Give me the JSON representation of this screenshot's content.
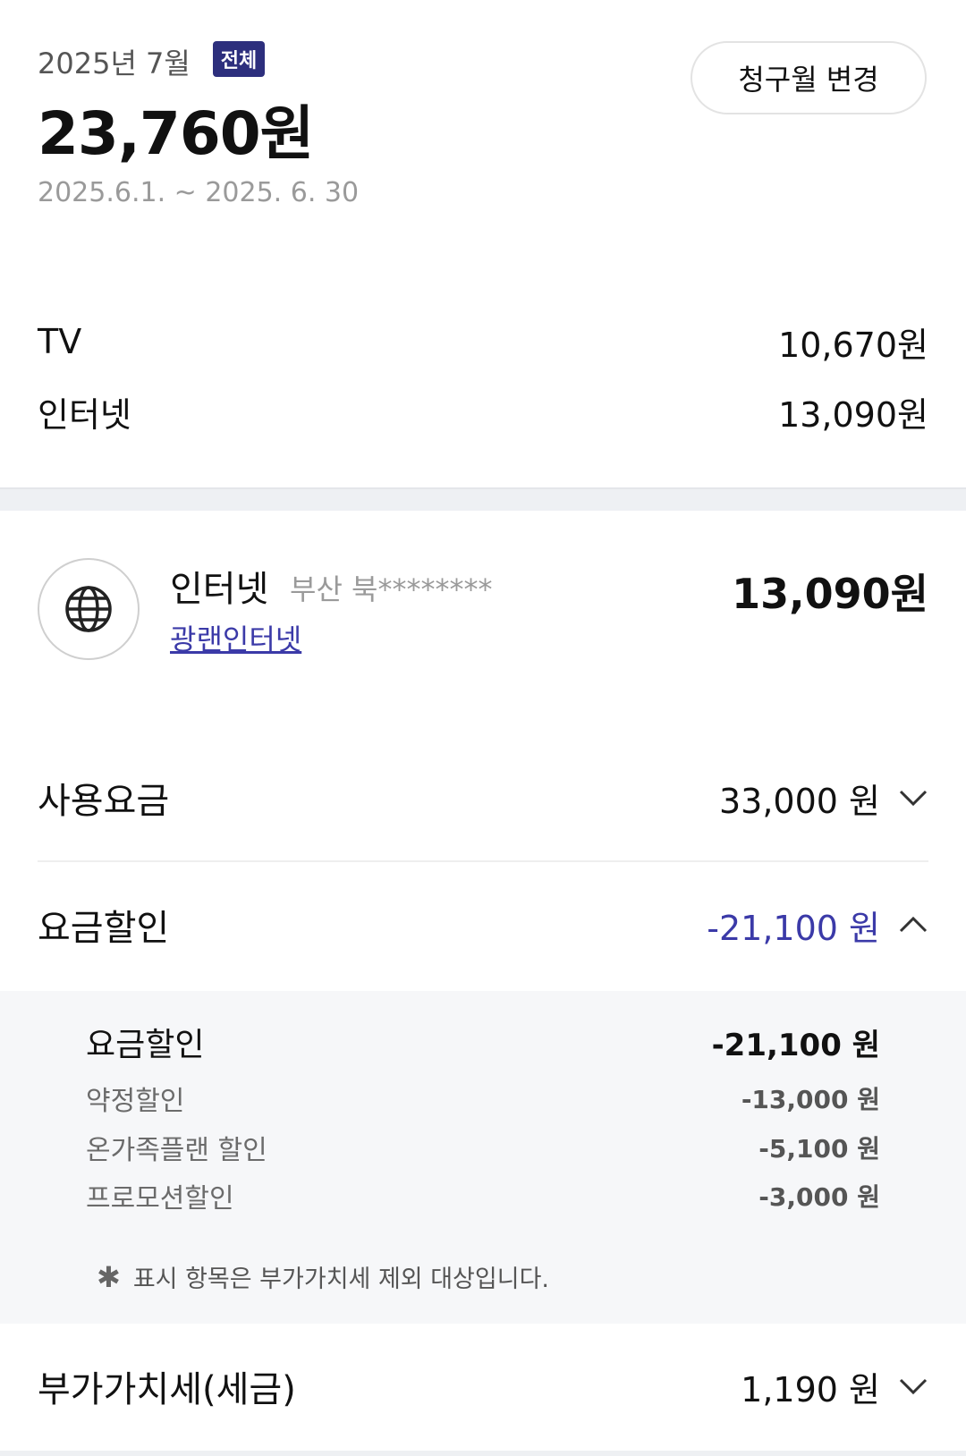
{
  "header": {
    "month_label": "2025년 7월",
    "badge": "전체",
    "total_amount": "23,760원",
    "period": "2025.6.1. ~ 2025. 6. 30",
    "change_button": "청구월 변경"
  },
  "summary": [
    {
      "label": "TV",
      "amount": "10,670원"
    },
    {
      "label": "인터넷",
      "amount": "13,090원"
    }
  ],
  "service": {
    "icon": "globe-icon",
    "name": "인터넷",
    "location": "부산 북********",
    "plan_link": "광랜인터넷",
    "amount": "13,090원"
  },
  "details": {
    "usage": {
      "label": "사용요금",
      "amount": "33,000 원",
      "icon": "chevron-down-icon"
    },
    "discount": {
      "label": "요금할인",
      "amount": "-21,100 원",
      "icon": "chevron-up-icon",
      "color": "#3b3aa8"
    },
    "vat": {
      "label": "부가가치세(세금)",
      "amount": "1,190 원",
      "icon": "chevron-down-icon"
    }
  },
  "discount_breakdown": {
    "header": {
      "label": "요금할인",
      "amount": "-21,100 원"
    },
    "items": [
      {
        "label": "약정할인",
        "amount": "-13,000 원"
      },
      {
        "label": "온가족플랜 할인",
        "amount": "-5,100 원"
      },
      {
        "label": "프로모션할인",
        "amount": "-3,000 원"
      }
    ],
    "note_mark": "✱",
    "note": "표시 항목은 부가가치세 제외 대상입니다."
  },
  "colors": {
    "badge_bg": "#2d2f7d",
    "accent": "#3b3aa8",
    "panel_bg": "#f6f7f9"
  }
}
